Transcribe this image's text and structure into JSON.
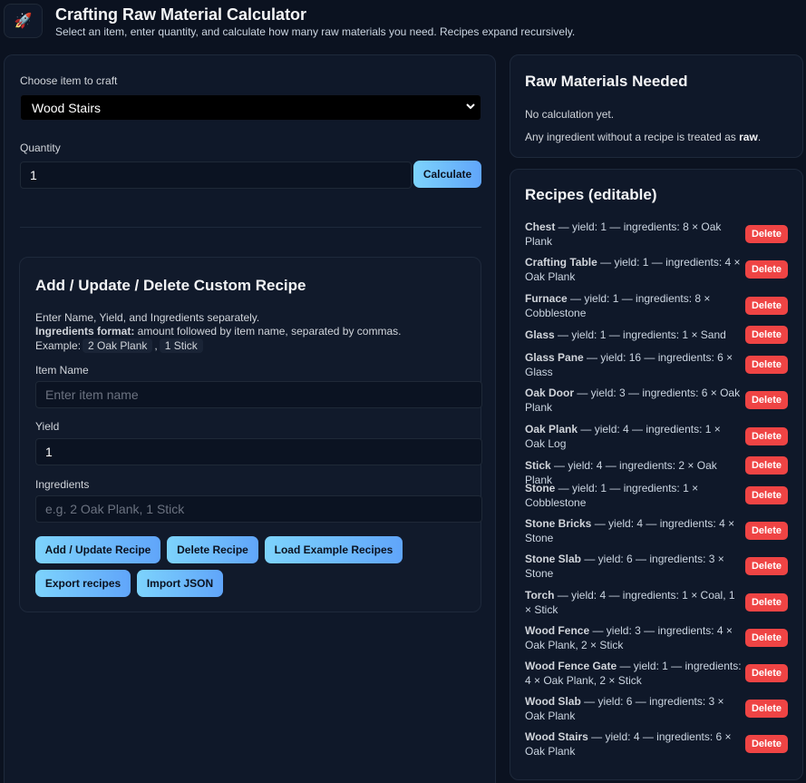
{
  "header": {
    "title": "Crafting Raw Material Calculator",
    "subtitle": "Select an item, enter quantity, and calculate how many raw materials you need. Recipes expand recursively.",
    "logo_icon": "🚀"
  },
  "calculator": {
    "item_label": "Choose item to craft",
    "item_selected": "Wood Stairs",
    "quantity_label": "Quantity",
    "quantity_value": "1",
    "calculate_label": "Calculate"
  },
  "custom_recipe": {
    "title": "Add / Update / Delete Custom Recipe",
    "intro": "Enter Name, Yield, and Ingredients separately.",
    "format_bold": "Ingredients format:",
    "format_text": " amount followed by item name, separated by commas.",
    "example_label": "Example:",
    "example_1": "2 Oak Plank",
    "example_sep": ",",
    "example_2": "1 Stick",
    "name_label": "Item Name",
    "name_placeholder": "Enter item name",
    "yield_label": "Yield",
    "yield_value": "1",
    "ingredients_label": "Ingredients",
    "ingredients_placeholder": "e.g. 2 Oak Plank, 1 Stick",
    "add_update_label": "Add / Update Recipe",
    "delete_label": "Delete Recipe",
    "load_example_label": "Load Example Recipes",
    "export_label": "Export recipes",
    "import_label": "Import JSON"
  },
  "raw_materials": {
    "title": "Raw Materials Needed",
    "status": "No calculation yet.",
    "note_prefix": "Any ingredient without a recipe is treated as ",
    "note_bold": "raw",
    "note_suffix": "."
  },
  "recipes": {
    "title": "Recipes (editable)",
    "delete_label": "Delete",
    "items": [
      {
        "name": "Chest",
        "details": " — yield: 1 — ingredients: 8 × Oak Plank"
      },
      {
        "name": "Crafting Table",
        "details": " — yield: 1 — ingredients: 4 × Oak Plank"
      },
      {
        "name": "Furnace",
        "details": " — yield: 1 — ingredients: 8 × Cobblestone"
      },
      {
        "name": "Glass",
        "details": " — yield: 1 — ingredients: 1 × Sand"
      },
      {
        "name": "Glass Pane",
        "details": " — yield: 16 — ingredients: 6 × Glass"
      },
      {
        "name": "Oak Door",
        "details": " — yield: 3 — ingredients: 6 × Oak Plank"
      },
      {
        "name": "Oak Plank",
        "details": " — yield: 4 — ingredients: 1 × Oak Log"
      },
      {
        "name": "Stick",
        "details": " — yield: 4 — ingredients: 2 × Oak Plank"
      },
      {
        "name": "Stone",
        "details": " — yield: 1 — ingredients: 1 × Cobblestone"
      },
      {
        "name": "Stone Bricks",
        "details": " — yield: 4 — ingredients: 4 × Stone"
      },
      {
        "name": "Stone Slab",
        "details": " — yield: 6 — ingredients: 3 × Stone"
      },
      {
        "name": "Torch",
        "details": " — yield: 4 — ingredients: 1 × Coal, 1 × Stick"
      },
      {
        "name": "Wood Fence",
        "details": " — yield: 3 — ingredients: 4 × Oak Plank, 2 × Stick"
      },
      {
        "name": "Wood Fence Gate",
        "details": " — yield: 1 — ingredients: 4 × Oak Plank, 2 × Stick"
      },
      {
        "name": "Wood Slab",
        "details": " — yield: 6 — ingredients: 3 × Oak Plank"
      },
      {
        "name": "Wood Stairs",
        "details": " — yield: 4 — ingredients: 6 × Oak Plank"
      }
    ]
  }
}
